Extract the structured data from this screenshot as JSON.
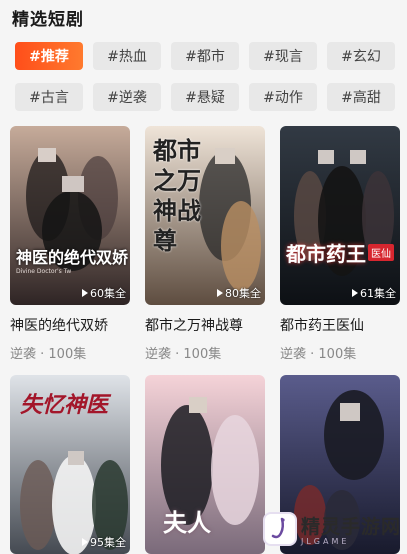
{
  "section": {
    "title": "精选短剧"
  },
  "tags": [
    [
      {
        "label": "#推荐",
        "active": true
      },
      {
        "label": "#热血"
      },
      {
        "label": "#都市"
      },
      {
        "label": "#现言"
      },
      {
        "label": "#玄幻"
      }
    ],
    [
      {
        "label": "#古言"
      },
      {
        "label": "#逆袭"
      },
      {
        "label": "#悬疑"
      },
      {
        "label": "#动作"
      },
      {
        "label": "#高甜"
      }
    ]
  ],
  "cards": [
    {
      "title": "神医的绝代双娇",
      "meta": "逆袭 · 100集",
      "episodes": "60集全",
      "poster_text": "神医的绝代双娇",
      "poster_sub": "Divine Doctor's Tw",
      "bg1": "#b89a8c",
      "bg2": "#3a2e2e"
    },
    {
      "title": "都市之万神战尊",
      "meta": "逆袭 · 100集",
      "episodes": "80集全",
      "poster_text": "都市之万神战尊",
      "bg1": "#e9dccf",
      "bg2": "#6d5a4b"
    },
    {
      "title": "都市药王医仙",
      "meta": "逆袭 · 100集",
      "episodes": "61集全",
      "poster_text": "都市药王",
      "poster_badge": "医仙",
      "bg1": "#2a3038",
      "bg2": "#0e1116"
    },
    {
      "title": "",
      "meta": "",
      "episodes": "95集全",
      "poster_text": "失忆神医",
      "bg1": "#d9dde3",
      "bg2": "#4a4e55"
    },
    {
      "title": "",
      "meta": "",
      "episodes": "",
      "poster_text": "夫人",
      "bg1": "#f2c9cf",
      "bg2": "#7a6a7a"
    },
    {
      "title": "",
      "meta": "",
      "episodes": "",
      "poster_text": "",
      "bg1": "#4d4e78",
      "bg2": "#1a1b2e"
    }
  ],
  "watermark": {
    "name": "精灵手游网",
    "sub": "JLGAME"
  }
}
